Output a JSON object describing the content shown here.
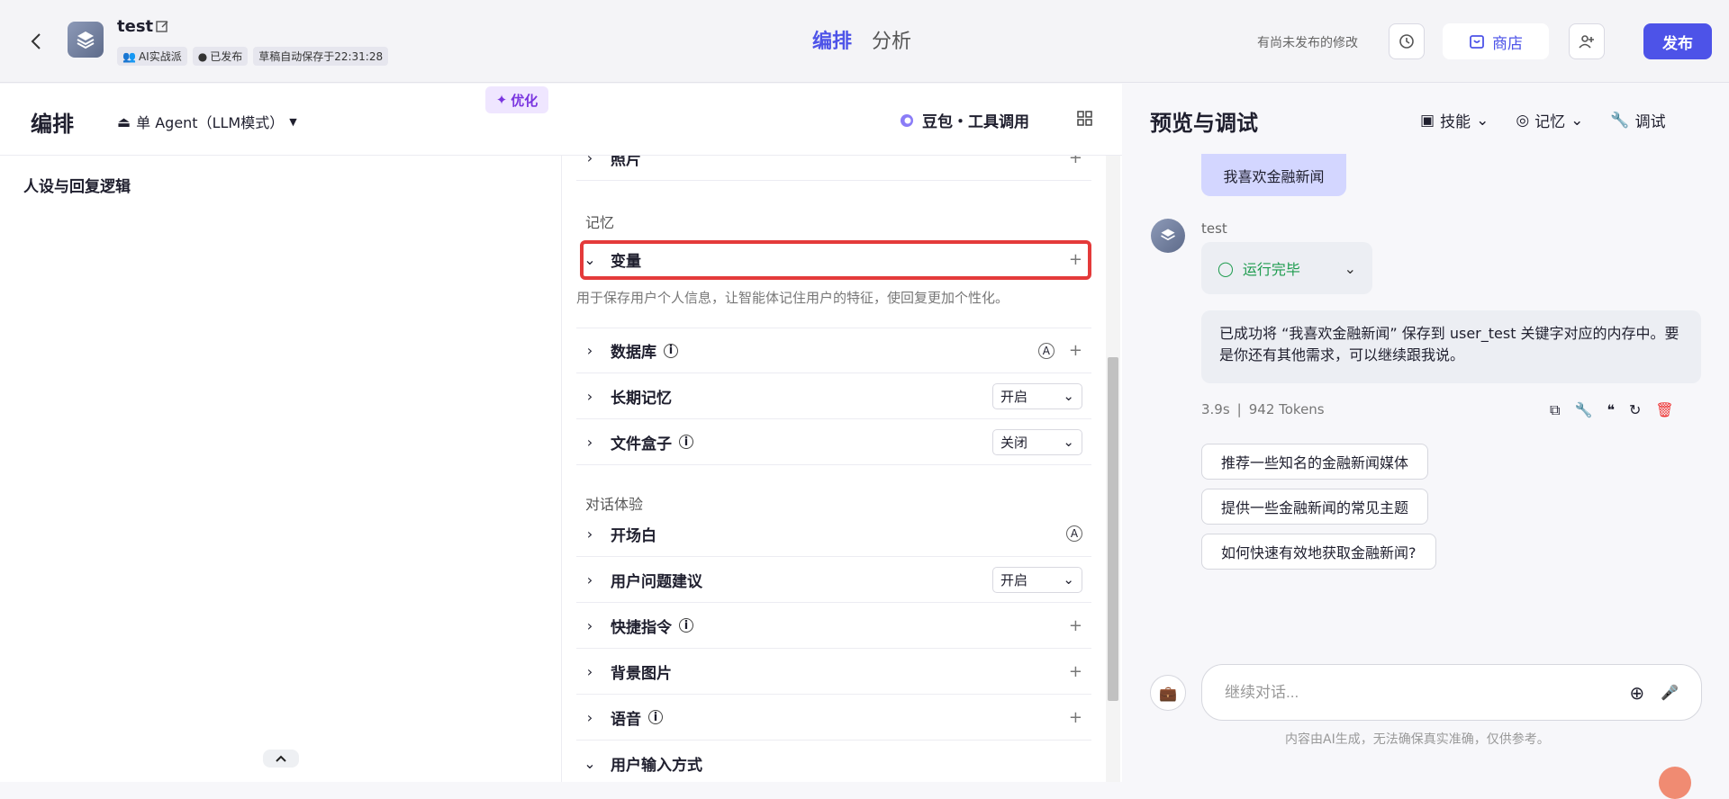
{
  "header": {
    "app_name": "test",
    "badges": [
      "AI实战派",
      "已发布",
      "草稿自动保存于22:31:28"
    ],
    "tabs": [
      "编排",
      "分析"
    ],
    "unsaved": "有尚未发布的修改",
    "store_label": "商店",
    "publish_label": "发布"
  },
  "orchestrate": {
    "title": "编排",
    "mode": "单 Agent（LLM模式）",
    "model": "豆包・工具调用",
    "persona_title": "人设与回复逻辑",
    "optimize_label": "优化"
  },
  "config": {
    "photo": "照片",
    "memory_section": "记忆",
    "variable": "变量",
    "variable_desc": "用于保存用户个人信息，让智能体记住用户的特征，使回复更加个性化。",
    "database": "数据库",
    "long_memory": "长期记忆",
    "long_memory_value": "开启",
    "file_box": "文件盒子",
    "file_box_value": "关闭",
    "dialog_section": "对话体验",
    "opening": "开场白",
    "suggestion": "用户问题建议",
    "suggestion_value": "开启",
    "shortcut": "快捷指令",
    "background": "背景图片",
    "voice": "语音",
    "input_method": "用户输入方式"
  },
  "preview": {
    "title": "预览与调试",
    "tools": [
      "技能",
      "记忆",
      "调试"
    ],
    "user_msg": "我喜欢金融新闻",
    "bot_name": "test",
    "run_status": "运行完毕",
    "reply": "已成功将 “我喜欢金融新闻” 保存到 user_test 关键字对应的内存中。要是你还有其他需求，可以继续跟我说。",
    "time": "3.9s",
    "tokens": "942 Tokens",
    "suggestions": [
      "推荐一些知名的金融新闻媒体",
      "提供一些金融新闻的常见主题",
      "如何快速有效地获取金融新闻?"
    ],
    "input_placeholder": "继续对话...",
    "disclaimer": "内容由AI生成，无法确保真实准确，仅供参考。"
  }
}
